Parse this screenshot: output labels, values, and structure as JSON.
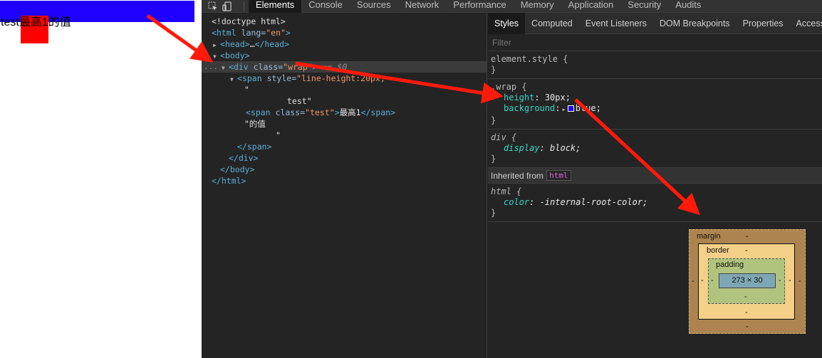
{
  "preview": {
    "text": "test最高1的值",
    "wrap_color": "#1f00ff",
    "test_color": "#ff0000"
  },
  "devtools": {
    "tabs": [
      "Elements",
      "Console",
      "Sources",
      "Network",
      "Performance",
      "Memory",
      "Application",
      "Security",
      "Audits"
    ],
    "active_tab": "Elements",
    "icons": [
      "inspect-element-icon",
      "device-toolbar-icon"
    ],
    "dom": {
      "doctype": "<!doctype html>",
      "html_tag": "html",
      "lang_attr": "lang",
      "lang_val": "\"en\"",
      "head": "head",
      "head_collapsed": "…",
      "body": "body",
      "div_tag": "div",
      "class_attr": "class",
      "div_class": "\"wrap\"",
      "dollar": "== $0",
      "span_tag": "span",
      "style_attr": "style",
      "span_style": "\"line-height:20px;",
      "text_quote_open": "\"",
      "text_test": "test\"",
      "span_class": "\"test\"",
      "span_text": "最高1",
      "after_text": "\"的值",
      "after_quote": "\"",
      "close_span": "</span>",
      "close_div": "</div>",
      "close_body": "</body>",
      "close_html": "</html>",
      "ellipsis": "..."
    },
    "styles": {
      "subtabs": [
        "Styles",
        "Computed",
        "Event Listeners",
        "DOM Breakpoints",
        "Properties",
        "Access"
      ],
      "active_subtab": "Styles",
      "filter_placeholder": "Filter",
      "element_style": "element.style {",
      "close_brace": "}",
      "wrap_selector": ".wrap {",
      "height_name": "height",
      "height_val": "30px;",
      "bg_name": "background",
      "bg_val": "blue;",
      "div_selector": "div {",
      "display_name": "display",
      "display_val": "block;",
      "inherited_label": "Inherited from",
      "inherited_tag": "html",
      "html_selector": "html {",
      "color_name": "color",
      "color_val": "-internal-root-color;"
    },
    "box_model": {
      "margin_label": "margin",
      "border_label": "border",
      "padding_label": "padding",
      "content_size": "273 × 30",
      "dash": "-"
    }
  },
  "annotation_color": "#ff1a0a"
}
